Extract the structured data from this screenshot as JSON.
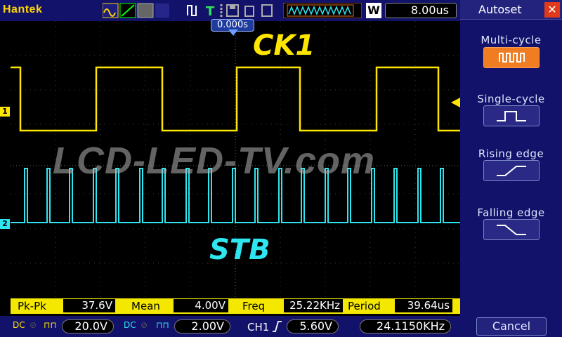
{
  "toolbar": {
    "brand": "Hantek",
    "timebase": "8.00us",
    "zoom_letter": "W"
  },
  "screen": {
    "trigger_position": "0.000s",
    "ch1_label": "CK1",
    "ch2_label": "STB",
    "watermark": "LCD-LED-TV.com",
    "ch1_marker": "1",
    "ch2_marker": "2"
  },
  "measurements": [
    {
      "name": "Pk-Pk",
      "value": "37.6V"
    },
    {
      "name": "Mean",
      "value": "4.00V"
    },
    {
      "name": "Freq",
      "value": "25.22KHz"
    },
    {
      "name": "Period",
      "value": "39.64us"
    }
  ],
  "status": {
    "ch1_scale": "20.0V",
    "ch2_scale": "2.00V",
    "trigger_source": "CH1",
    "trigger_level": "5.60V",
    "trigger_freq": "24.1150KHz",
    "coupling": "DC"
  },
  "autoset_panel": {
    "title": "Autoset",
    "options": [
      {
        "label": "Multi-cycle",
        "active": true
      },
      {
        "label": "Single-cycle",
        "active": false
      },
      {
        "label": "Rising edge",
        "active": false
      },
      {
        "label": "Falling edge",
        "active": false
      }
    ],
    "cancel_label": "Cancel"
  },
  "colors": {
    "ch1": "#ffe600",
    "ch2": "#2ee6f0",
    "accent": "#f07d22"
  }
}
